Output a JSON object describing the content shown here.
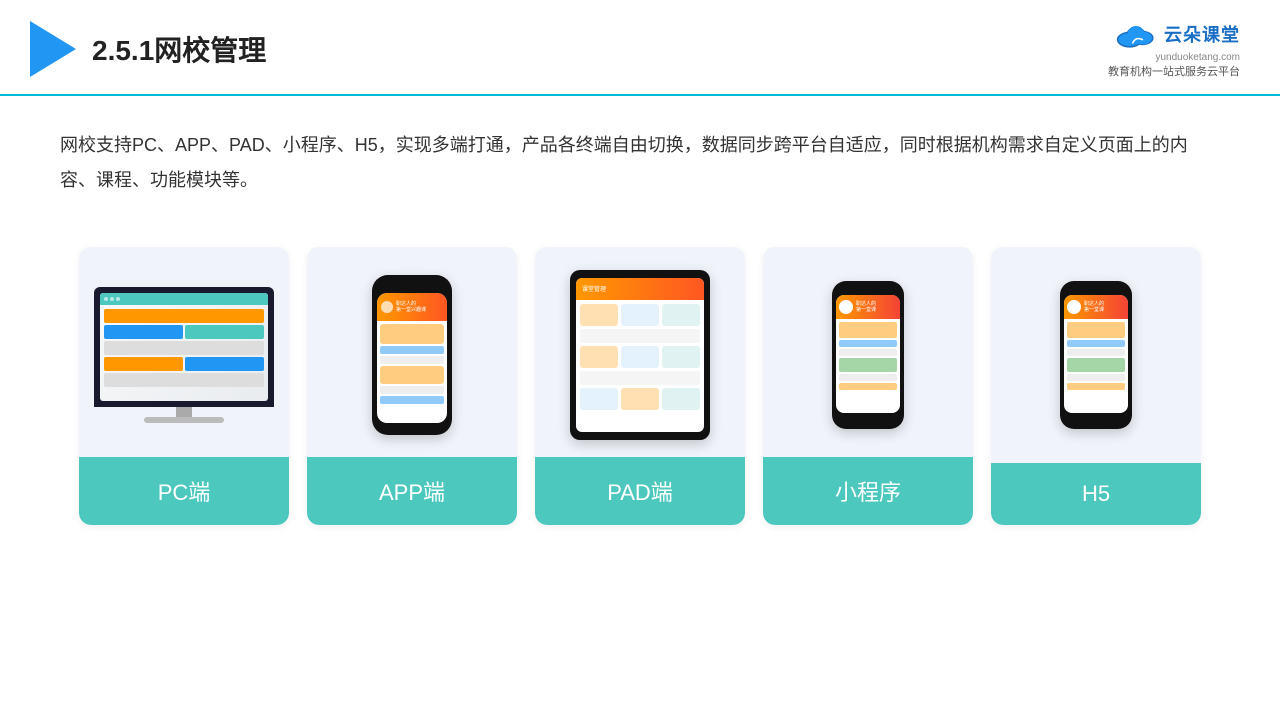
{
  "header": {
    "title": "2.5.1网校管理",
    "brand_name": "云朵课堂",
    "brand_url": "yunduoketang.com",
    "brand_slogan_line1": "教育机构一站",
    "brand_slogan_line2": "式服务云平台"
  },
  "description": {
    "text": "网校支持PC、APP、PAD、小程序、H5，实现多端打通，产品各终端自由切换，数据同步跨平台自适应，同时根据机构需求自定义页面上的内容、课程、功能模块等。"
  },
  "cards": [
    {
      "id": "pc",
      "label": "PC端"
    },
    {
      "id": "app",
      "label": "APP端"
    },
    {
      "id": "pad",
      "label": "PAD端"
    },
    {
      "id": "mini",
      "label": "小程序"
    },
    {
      "id": "h5",
      "label": "H5"
    }
  ],
  "colors": {
    "accent": "#4dc8bf",
    "header_line": "#00bcd4",
    "card_bg": "#f0f4fa",
    "title_color": "#222"
  }
}
